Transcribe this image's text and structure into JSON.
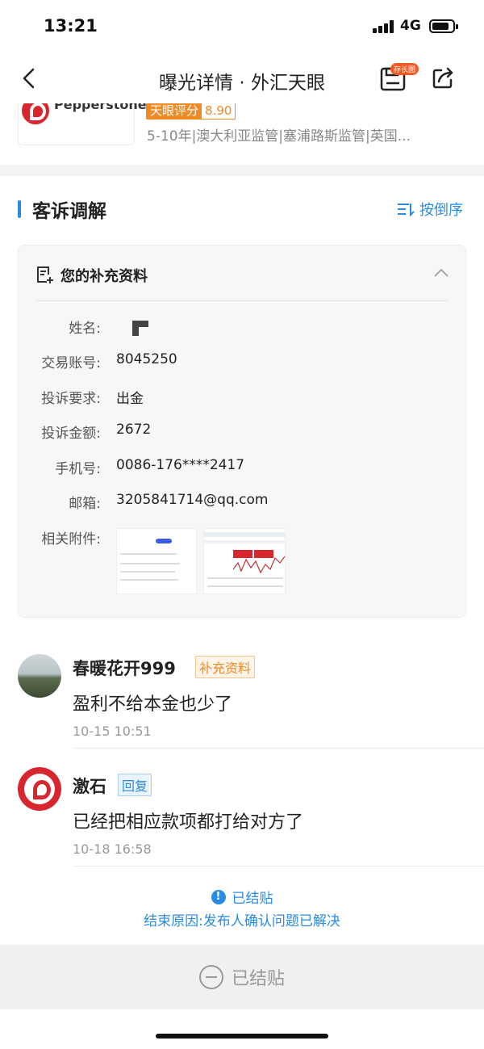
{
  "status": {
    "time": "13:21",
    "network": "4G",
    "battery_level": 0.85
  },
  "nav": {
    "title": "曝光详情 · 外汇天眼",
    "long_image_badge": "存长图"
  },
  "broker": {
    "logo_text": "Pepperstone",
    "rating_label": "天眼评分",
    "rating_value": "8.90",
    "meta": "5-10年|澳大利亚监管|塞浦路斯监管|英国..."
  },
  "section": {
    "title": "客诉调解",
    "sort_label": "按倒序"
  },
  "card": {
    "title": "您的补充资料",
    "fields": [
      {
        "label": "姓名:",
        "value": ""
      },
      {
        "label": "交易账号:",
        "value": "8045250"
      },
      {
        "label": "投诉要求:",
        "value": "出金"
      },
      {
        "label": "投诉金额:",
        "value": "2672"
      },
      {
        "label": "手机号:",
        "value": "0086-176****2417"
      },
      {
        "label": "邮箱:",
        "value": "3205841714@qq.com"
      },
      {
        "label": "相关附件:",
        "value": ""
      }
    ]
  },
  "comments": [
    {
      "name": "春暖花开999",
      "tag": "补充资料",
      "text": "盈利不给本金也少了",
      "time": "10-15 10:51"
    },
    {
      "name": "激石",
      "tag": "回复",
      "text": "已经把相应款项都打给对方了",
      "time": "10-18 16:58"
    }
  ],
  "closed": {
    "status": "已结贴",
    "reason": "结束原因:发布人确认问题已解决"
  },
  "bottom": {
    "label": "已结贴"
  },
  "colors": {
    "accent": "#2a8be3",
    "brand_red": "#d7262e",
    "rating_orange": "#f08a24"
  }
}
